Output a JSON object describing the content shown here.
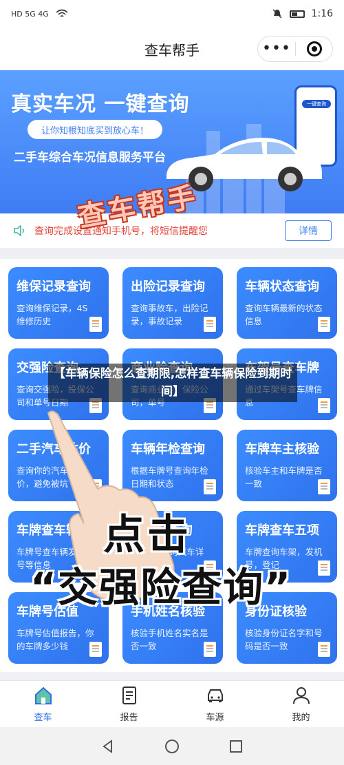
{
  "status": {
    "time": "1:16",
    "left_text": "HD 5G 4G",
    "wifi": "wifi-icon",
    "battery": "battery-icon"
  },
  "header": {
    "title": "查车帮手",
    "more_icon": "more-dots-icon",
    "target_icon": "target-icon"
  },
  "banner": {
    "headline": "真实车况 一键查询",
    "pill": "让你知根知底买到放心车！",
    "subtitle": "二手车综合车况信息服务平台",
    "phone_button": "一键查询"
  },
  "watermark": "查车帮手",
  "notice": {
    "message": "查询完成设置通知手机号，将短信提醒您",
    "detail_button": "详情"
  },
  "cards": [
    {
      "title": "维保记录查询",
      "desc": "查询维保记录，4S维修历史"
    },
    {
      "title": "出险记录查询",
      "desc": "查询事故车，出险记录，事故记录"
    },
    {
      "title": "车辆状态查询",
      "desc": "查询车辆最新的状态信息"
    },
    {
      "title": "交强险查询",
      "desc": "查询交强险，投保公司和单号日期"
    },
    {
      "title": "商业险查询",
      "desc": "查询商业险，保险公司，单号"
    },
    {
      "title": "车架号查车牌",
      "desc": "通过车架号查车牌信息"
    },
    {
      "title": "二手汽车估价",
      "desc": "查询你的汽车回收价，避免被坑"
    },
    {
      "title": "车辆年检查询",
      "desc": "根据车牌号查询年检日期和状态"
    },
    {
      "title": "车牌车主核验",
      "desc": "核验车主和车牌是否一致"
    },
    {
      "title": "车牌查车辆",
      "desc": "车牌号查车辆发动机号等信息"
    },
    {
      "title": "VIN码查询",
      "desc": "输入vin查询汽车详细配置"
    },
    {
      "title": "车牌查车五项",
      "desc": "车牌查询车架，发机号，登记"
    },
    {
      "title": "车牌号估值",
      "desc": "车牌号估值报告，你的车牌多少钱"
    },
    {
      "title": "手机姓名核验",
      "desc": "核验手机姓名实名是否一致"
    },
    {
      "title": "身份证核验",
      "desc": "核验身份证名字和号码是否一致"
    }
  ],
  "overlay": {
    "caption": "【车辆保险怎么查期限,怎样查车辆保险到期时间】",
    "big_line1": "点击",
    "big_line2": "“交强险查询”"
  },
  "tabs": [
    {
      "label": "查车",
      "icon": "home-icon",
      "active": true
    },
    {
      "label": "报告",
      "icon": "report-icon",
      "active": false
    },
    {
      "label": "车源",
      "icon": "car-icon",
      "active": false
    },
    {
      "label": "我的",
      "icon": "user-icon",
      "active": false
    }
  ],
  "colors": {
    "accent": "#2f6fe6",
    "banner": "#3f7cf4",
    "notice_text": "#e4453b"
  }
}
